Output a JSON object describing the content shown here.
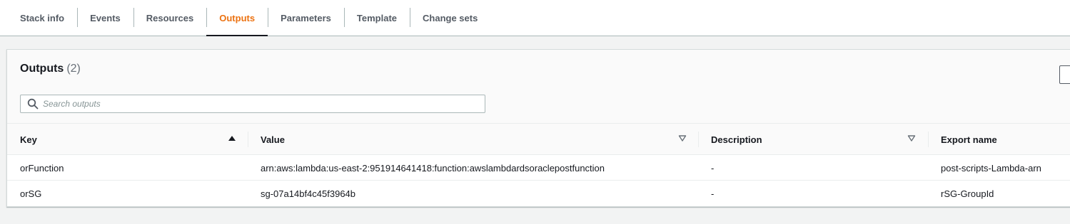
{
  "tabs": [
    {
      "label": "Stack info",
      "active": false
    },
    {
      "label": "Events",
      "active": false
    },
    {
      "label": "Resources",
      "active": false
    },
    {
      "label": "Outputs",
      "active": true
    },
    {
      "label": "Parameters",
      "active": false
    },
    {
      "label": "Template",
      "active": false
    },
    {
      "label": "Change sets",
      "active": false
    }
  ],
  "panel": {
    "title": "Outputs",
    "count": "(2)"
  },
  "search": {
    "placeholder": "Search outputs",
    "value": "",
    "icon": "search-icon"
  },
  "table": {
    "columns": [
      "Key",
      "Value",
      "Description",
      "Export name"
    ],
    "sort_icons": {
      "key": "sort-ascending-icon",
      "value": "sort-caret-icon",
      "description": "sort-caret-icon"
    },
    "rows": [
      {
        "key": "orFunction",
        "value": "arn:aws:lambda:us-east-2:951914641418:function:awslambdardsoraclepostfunction",
        "description": "-",
        "export_name": "post-scripts-Lambda-arn"
      },
      {
        "key": "orSG",
        "value": "sg-07a14bf4c45f3964b",
        "description": "-",
        "export_name": "rSG-GroupId"
      }
    ]
  },
  "colors": {
    "active_tab": "#ec7211",
    "text": "#16191f",
    "muted": "#545b64",
    "background": "#f2f3f3",
    "panel": "#ffffff",
    "border": "#aab7b8"
  }
}
